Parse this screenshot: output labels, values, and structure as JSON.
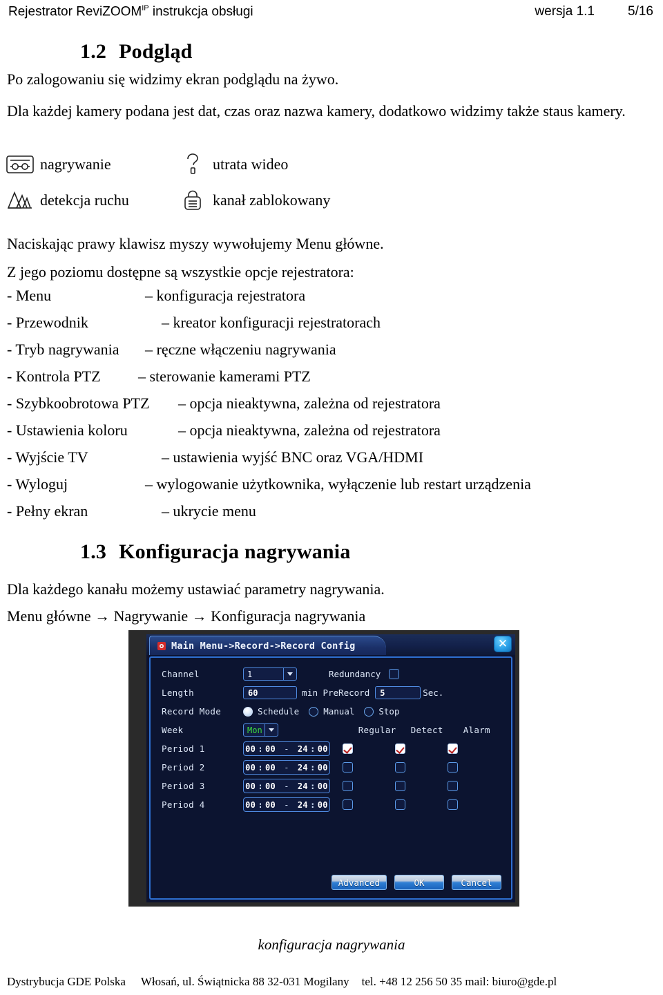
{
  "header": {
    "title_main": "Rejestrator ReviZOOM",
    "title_sup": "IP",
    "title_rest": " instrukcja obsługi",
    "version": "wersja 1.1",
    "page": "5/16"
  },
  "section_1_2": {
    "number": "1.2",
    "title": "Podgląd",
    "para1": "Po zalogowaniu się widzimy ekran podglądu na żywo.",
    "para2": "Dla każdej kamery podana jest dat, czas oraz nazwa kamery, dodatkowo widzimy także staus kamery."
  },
  "legend": {
    "items": [
      {
        "icon": "record-tape-icon",
        "label": "nagrywanie"
      },
      {
        "icon": "video-loss-question-icon",
        "label": "utrata wideo"
      },
      {
        "icon": "motion-detection-icon",
        "label": "detekcja ruchu"
      },
      {
        "icon": "channel-locked-icon",
        "label": "kanał zablokowany"
      }
    ]
  },
  "intro": {
    "line1": "Naciskając prawy klawisz myszy wywołujemy Menu główne.",
    "line2": "Z jego poziomu dostępne są wszystkie opcje rejestratora:"
  },
  "menu_options": [
    {
      "term": "- Menu",
      "desc": "– konfiguracja rejestratora",
      "term_w": 200,
      "desc_indent": 0
    },
    {
      "term": "- Przewodnik",
      "desc": "– kreator konfiguracji rejestratorach",
      "term_w": 212,
      "desc_indent": 12
    },
    {
      "term": "- Tryb nagrywania",
      "desc": "– ręczne włączeniu nagrywania",
      "term_w": 200,
      "desc_indent": 12
    },
    {
      "term": "- Kontrola PTZ",
      "desc": "– sterowanie kamerami PTZ",
      "term_w": 190,
      "desc_indent": 12
    },
    {
      "term": "- Szybkoobrotowa PTZ",
      "desc": "– opcja nieaktywna, zależna od rejestratora",
      "term_w": 248,
      "desc_indent": 12
    },
    {
      "term": "- Ustawienia koloru",
      "desc": "– opcja nieaktywna, zależna od rejestratora",
      "term_w": 248,
      "desc_indent": 12
    },
    {
      "term": "- Wyjście TV",
      "desc": "– ustawienia wyjść BNC oraz VGA/HDMI",
      "term_w": 212,
      "desc_indent": 12
    },
    {
      "term": "- Wyloguj",
      "desc": "– wylogowanie użytkownika, wyłączenie lub restart urządzenia",
      "term_w": 200,
      "desc_indent": 12
    },
    {
      "term": "- Pełny ekran",
      "desc": "– ukrycie menu",
      "term_w": 212,
      "desc_indent": 12
    }
  ],
  "section_1_3": {
    "number": "1.3",
    "title": "Konfiguracja nagrywania",
    "para1": "Dla każdego kanału możemy ustawiać parametry nagrywania.",
    "breadcrumb": "Menu główne → Nagrywanie → Konfiguracja nagrywania"
  },
  "dvr_dialog": {
    "titlebar": "Main Menu->Record->Record Config",
    "gear_icon": "gear-icon",
    "close_icon": "close-icon",
    "fields": {
      "channel_label": "Channel",
      "channel_value": "1",
      "redundancy_label": "Redundancy",
      "redundancy_checked": false,
      "length_label": "Length",
      "length_value": "60",
      "length_unit": "min",
      "prerecord_label": "PreRecord",
      "prerecord_value": "5",
      "prerecord_unit": "Sec.",
      "record_mode_label": "Record Mode",
      "record_mode_options": [
        "Schedule",
        "Manual",
        "Stop"
      ],
      "record_mode_selected": "Schedule",
      "week_label": "Week",
      "week_value": "Mon"
    },
    "columns": [
      "Regular",
      "Detect",
      "Alarm"
    ],
    "periods": [
      {
        "label": "Period 1",
        "start_h": "00",
        "start_m": "00",
        "end_h": "24",
        "end_m": "00",
        "regular": true,
        "detect": true,
        "alarm": true
      },
      {
        "label": "Period 2",
        "start_h": "00",
        "start_m": "00",
        "end_h": "24",
        "end_m": "00",
        "regular": false,
        "detect": false,
        "alarm": false
      },
      {
        "label": "Period 3",
        "start_h": "00",
        "start_m": "00",
        "end_h": "24",
        "end_m": "00",
        "regular": false,
        "detect": false,
        "alarm": false
      },
      {
        "label": "Period 4",
        "start_h": "00",
        "start_m": "00",
        "end_h": "24",
        "end_m": "00",
        "regular": false,
        "detect": false,
        "alarm": false
      }
    ],
    "buttons": {
      "advanced": "Advanced",
      "ok": "OK",
      "cancel": "Cancel"
    },
    "colors": {
      "window_bg": "#0c1430",
      "border": "#2e6fd0",
      "accent_text": "#3ddc3d",
      "check_mark": "#b51f1f",
      "close_btn": "#2aa0e8"
    }
  },
  "caption": "konfiguracja nagrywania",
  "footer": {
    "company": "Dystrybucja GDE Polska",
    "address": "Włosań, ul. Świątnicka 88 32-031 Mogilany",
    "contact": "tel. +48 12 256 50 35 mail: biuro@gde.pl"
  }
}
